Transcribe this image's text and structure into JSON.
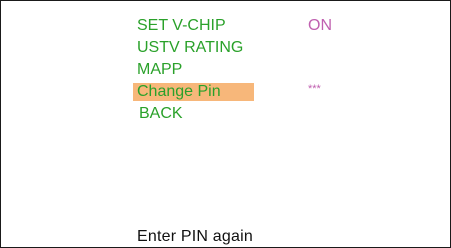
{
  "menu": {
    "items": [
      {
        "label": "SET V-CHIP",
        "value": "ON",
        "selected": false
      },
      {
        "label": "USTV RATING",
        "value": "",
        "selected": false
      },
      {
        "label": "MAPP",
        "value": "",
        "selected": false
      },
      {
        "label": "Change Pin",
        "value": "***",
        "selected": true
      },
      {
        "label": "BACK",
        "value": "",
        "selected": false
      }
    ]
  },
  "prompt": {
    "text": "Enter PIN again"
  },
  "colors": {
    "label": "#2aa12a",
    "value": "#c060b0",
    "highlight": "#f7b77a",
    "prompt": "#111111",
    "background": "#ffffff"
  }
}
